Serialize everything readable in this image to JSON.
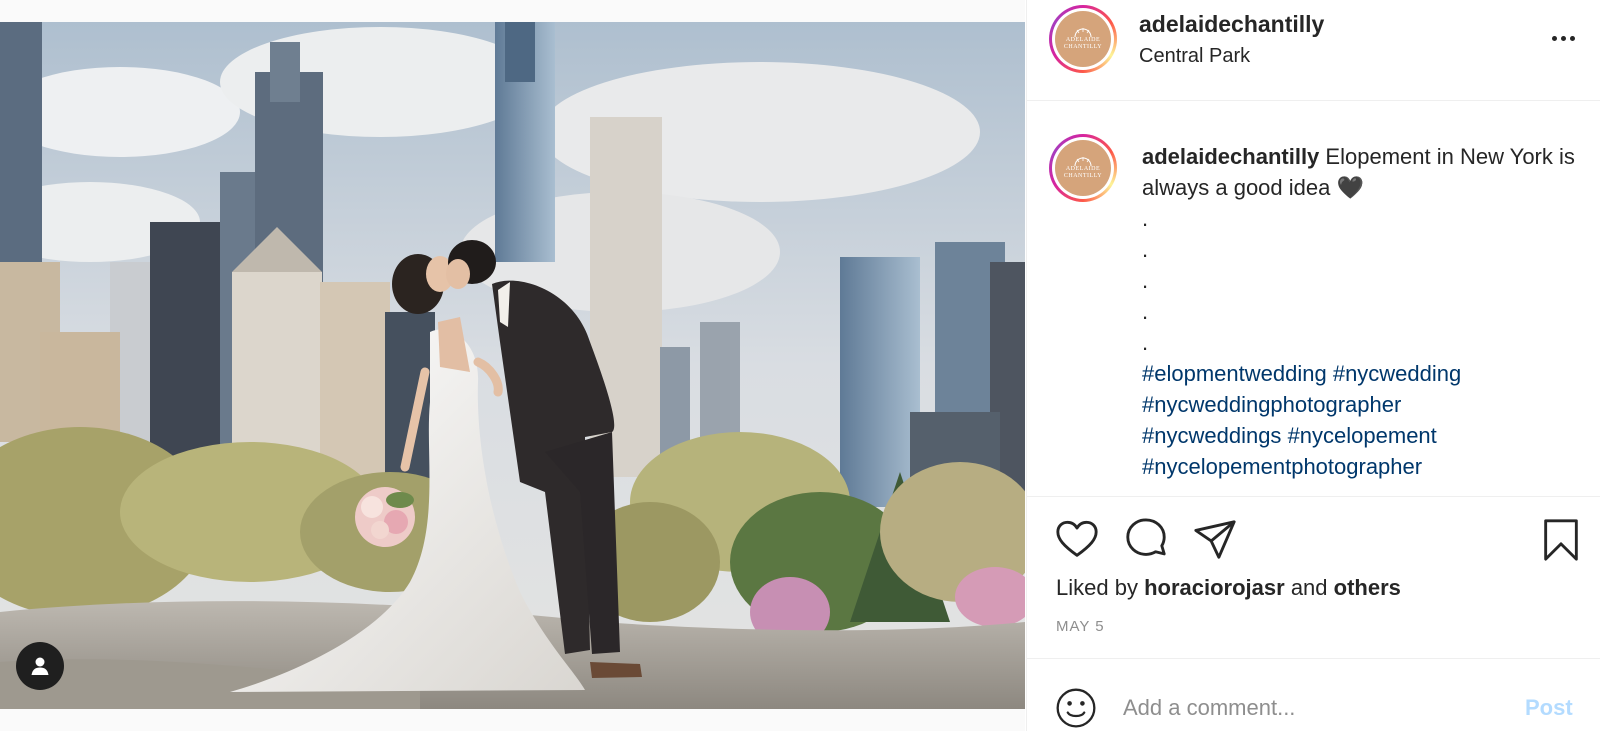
{
  "post": {
    "username": "adelaidechantilly",
    "location": "Central Park",
    "avatar_text": [
      "ADELAIDE",
      "CHANTILLY"
    ],
    "caption": {
      "username": "adelaidechantilly",
      "text": "Elopement in New York is always a good idea 🖤",
      "dots": [
        ".",
        ".",
        ".",
        ".",
        "."
      ],
      "hashtags": [
        "#elopmentwedding",
        "#nycwedding",
        "#nycweddingphotographer",
        "#nycweddings",
        "#nycelopement",
        "#nycelopementphotographer"
      ]
    },
    "likes": {
      "prefix": "Liked by",
      "user": "horaciorojasr",
      "joiner": "and",
      "others": "others"
    },
    "date": "MAY 5",
    "comment": {
      "placeholder": "Add a comment...",
      "post_label": "Post"
    }
  },
  "icons": {
    "more": "more-horizontal-icon",
    "like": "heart-icon",
    "comment": "speech-bubble-icon",
    "share": "paper-plane-icon",
    "save": "bookmark-icon",
    "emoji": "smiley-icon",
    "tag": "user-tag-icon"
  },
  "colors": {
    "hashtag": "#00376b",
    "post_button_disabled": "#b3dbff",
    "muted": "#8e8e8e",
    "text": "#262626"
  }
}
